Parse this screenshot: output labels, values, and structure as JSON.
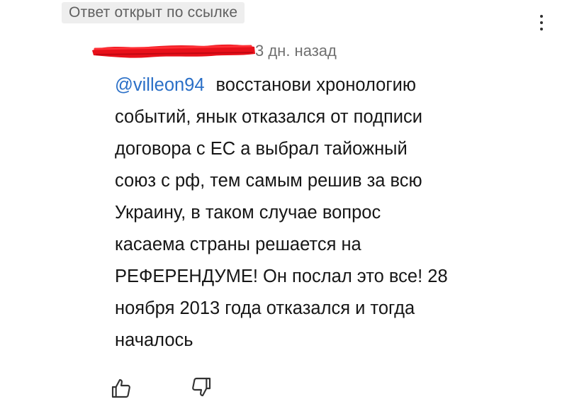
{
  "badge": {
    "label": "Ответ открыт по ссылке"
  },
  "comment": {
    "author_redacted": true,
    "timestamp": "3 дн. назад",
    "mention": "@villeon94",
    "lines": [
      "восстанови хронологию",
      "событий, янык отказался от подписи",
      "договора с ЕС а выбрал тайожный",
      "союз с рф, тем самым решив за всю",
      "Украину, в таком случае вопрос",
      "касаема страны решается на",
      "РЕФЕРЕНДУМЕ! Он послал это все! 28",
      "ноября 2013 года отказался и тогда",
      "началось"
    ]
  },
  "icons": {
    "more": "more-vertical-icon",
    "like": "thumbs-up-icon",
    "dislike": "thumbs-down-icon"
  },
  "colors": {
    "mention": "#2a6fc7",
    "redaction": "#e8101a",
    "badge_bg": "#eeeeee"
  }
}
